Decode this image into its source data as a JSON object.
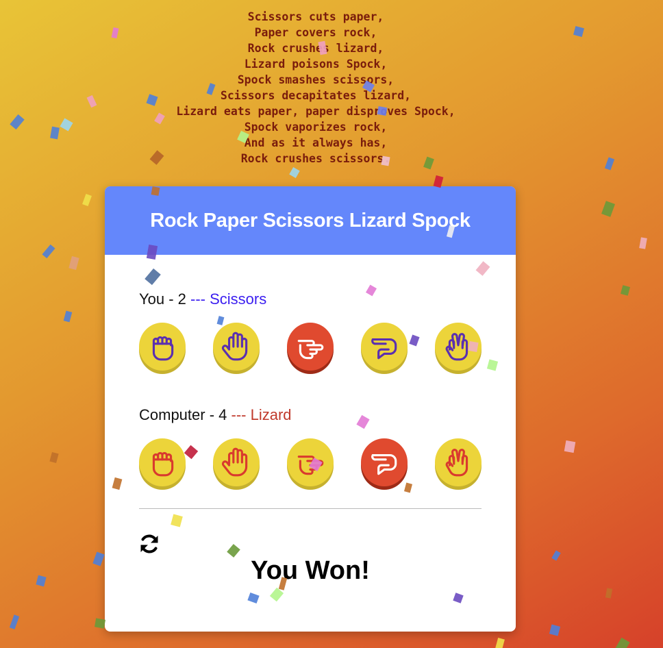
{
  "poem": [
    "Scissors cuts paper,",
    "Paper covers rock,",
    "Rock crushes lizard,",
    "Lizard poisons Spock,",
    "Spock smashes scissors,",
    "Scissors decapitates lizard,",
    "Lizard eats paper, paper disproves Spock,",
    "Spock vaporizes rock,",
    "And as it always has,",
    "Rock crushes scissors."
  ],
  "title": "Rock Paper Scissors Lizard Spock",
  "player": {
    "label": "You - 2",
    "separator": " --- ",
    "choice": "Scissors",
    "selected_index": 2
  },
  "computer": {
    "label": "Computer - 4",
    "separator": " --- ",
    "choice": "Lizard",
    "selected_index": 3
  },
  "hands": [
    "rock",
    "paper",
    "scissors",
    "lizard",
    "spock"
  ],
  "icons": {
    "reset": "refresh-icon"
  },
  "result": "You Won!",
  "colors": {
    "header": "#6487fb",
    "coin": "#ecd43a",
    "coin_selected": "#e04a2f",
    "player_icon": "#5a2fb0",
    "computer_icon": "#d93a2e",
    "player_choice_text": "#3b1ef0",
    "computer_choice_text": "#c0392b"
  }
}
